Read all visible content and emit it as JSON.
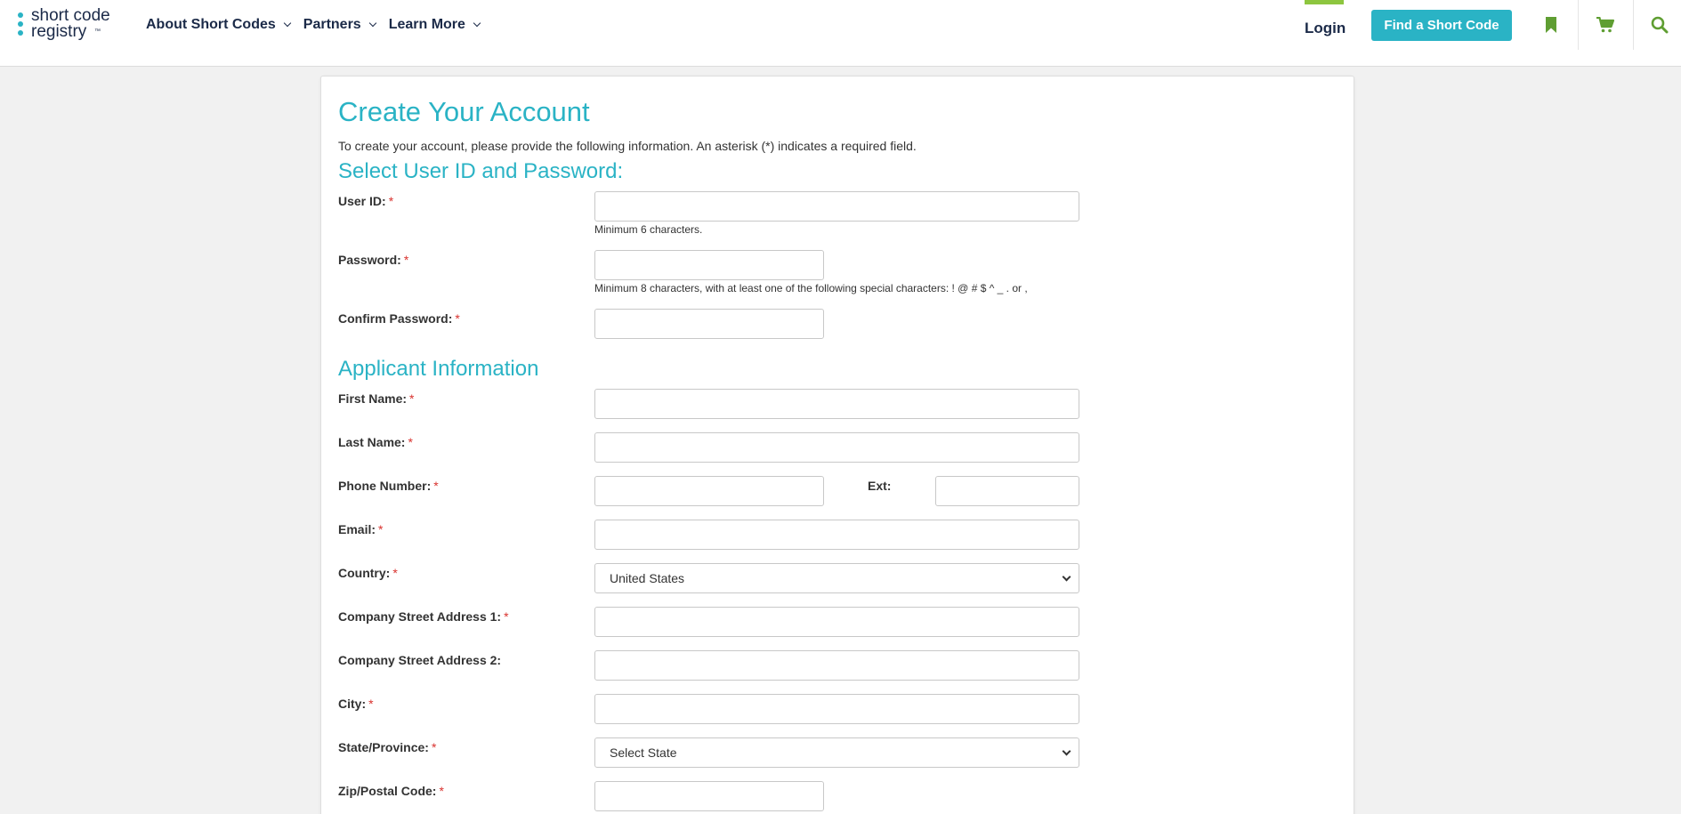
{
  "header": {
    "logo_line1": "short code",
    "logo_line2": "registry",
    "logo_tm": "™",
    "nav": [
      {
        "label": "About Short Codes"
      },
      {
        "label": "Partners"
      },
      {
        "label": "Learn More"
      }
    ],
    "login_label": "Login",
    "find_button": "Find a Short Code",
    "icons": [
      "bookmark-icon",
      "cart-icon",
      "search-icon"
    ],
    "colors": {
      "accent": "#2ab3c5",
      "brand_green": "#5f9e32",
      "navy": "#1b2a48",
      "required": "#d9322e"
    }
  },
  "form": {
    "title": "Create Your Account",
    "intro": "To create your account, please provide the following information. An asterisk (*) indicates a required field.",
    "section1": "Select User ID and Password:",
    "user_id_label": "User ID:",
    "user_id_hint": "Minimum 6 characters.",
    "password_label": "Password:",
    "password_hint": "Minimum 8 characters, with at least one of the following special characters: ! @ # $ ^ _ . or ,",
    "confirm_label": "Confirm Password:",
    "section2": "Applicant Information",
    "first_name_label": "First Name:",
    "last_name_label": "Last Name:",
    "phone_label": "Phone Number:",
    "ext_label": "Ext:",
    "email_label": "Email:",
    "country_label": "Country:",
    "country_value": "United States",
    "address1_label": "Company Street Address 1:",
    "address2_label": "Company Street Address 2:",
    "city_label": "City:",
    "state_label": "State/Province:",
    "state_value": "Select State",
    "zip_label": "Zip/Postal Code:",
    "required_mark": "*"
  }
}
